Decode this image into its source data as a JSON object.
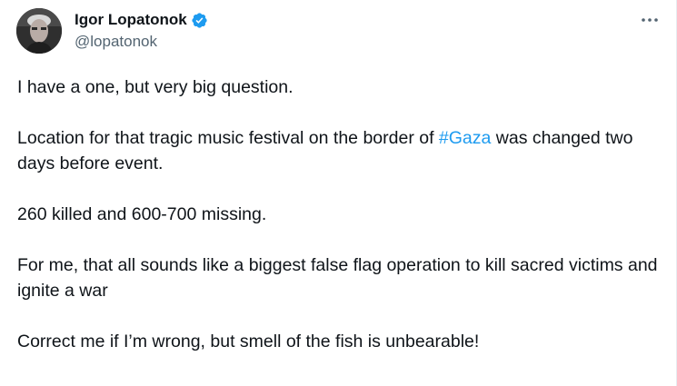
{
  "author": {
    "display_name": "Igor Lopatonok",
    "handle": "@lopatonok",
    "verified": true,
    "avatar_icon": "avatar-photo",
    "verified_icon": "verified-badge-icon",
    "verified_color": "#1d9bf0"
  },
  "more_icon": "more-horizontal-icon",
  "tweet": {
    "paragraph_1": "I have a one, but very big question.",
    "paragraph_2_part1": "Location for that tragic music festival on the border of ",
    "paragraph_2_hashtag": "#Gaza",
    "paragraph_2_part2": " was changed two days before event.",
    "paragraph_3": "260 killed and 600-700 missing.",
    "paragraph_4": "For me, that all sounds like a biggest false flag operation to kill sacred victims and ignite a war",
    "paragraph_5": "Correct me if I’m wrong, but smell of the fish is unbearable!"
  },
  "colors": {
    "text": "#0f1419",
    "secondary": "#536471",
    "link": "#1d9bf0"
  }
}
